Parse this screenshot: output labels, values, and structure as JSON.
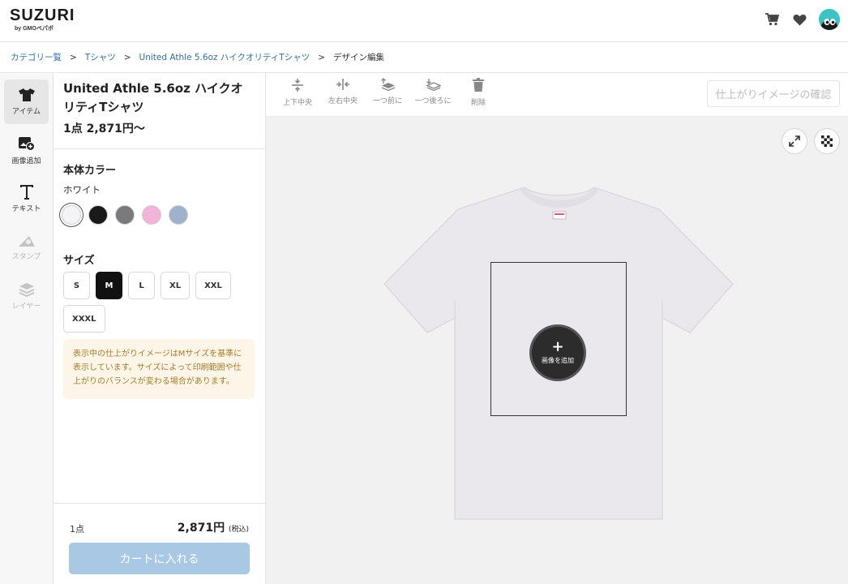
{
  "header": {
    "logo": "SUZURI",
    "logo_sub": "by GMOペパボ",
    "icons": [
      "cart-icon",
      "heart-icon",
      "avatar"
    ]
  },
  "breadcrumb": {
    "items": [
      "カテゴリー覧",
      "Tシャツ",
      "United Athle 5.6oz ハイクオリティTシャツ"
    ],
    "current": "デザイン編集",
    "separator": ">"
  },
  "tools": [
    {
      "label": "アイテム",
      "icon": "tshirt-icon",
      "state": "active"
    },
    {
      "label": "画像追加",
      "icon": "add-image-icon",
      "state": "normal"
    },
    {
      "label": "テキスト",
      "icon": "text-icon",
      "state": "normal"
    },
    {
      "label": "スタンプ",
      "icon": "stamp-icon",
      "state": "disabled"
    },
    {
      "label": "レイヤー",
      "icon": "layers-icon",
      "state": "disabled"
    }
  ],
  "product": {
    "title": "United Athle 5.6oz ハイクオリティTシャツ",
    "price_label": "1点 2,871円〜",
    "color_heading": "本体カラー",
    "selected_color": "ホワイト",
    "colors": [
      "#f4f4f6",
      "#1a1a1a",
      "#7a7a7d",
      "#f2b4d8",
      "#9fb2cc"
    ],
    "size_heading": "サイズ",
    "sizes": [
      "S",
      "M",
      "L",
      "XL",
      "XXL",
      "XXXL"
    ],
    "selected_size": "M",
    "notice": "表示中の仕上がりイメージはMサイズを基準に表示しています。サイズによって印刷範囲や仕上がりのバランスが変わる場合があります。"
  },
  "cart": {
    "quantity": "1点",
    "total": "2,871円",
    "tax": "(税込)",
    "button": "カートに入れる"
  },
  "toolbar": {
    "actions": [
      "上下中央",
      "左右中央",
      "一つ前に",
      "一つ後ろに",
      "削除"
    ],
    "confirm": "仕上がりイメージの確認"
  },
  "canvas": {
    "add_image_label": "画像を追加",
    "add_image_symbol": "+",
    "shirt_color": "#ebe8ed"
  }
}
